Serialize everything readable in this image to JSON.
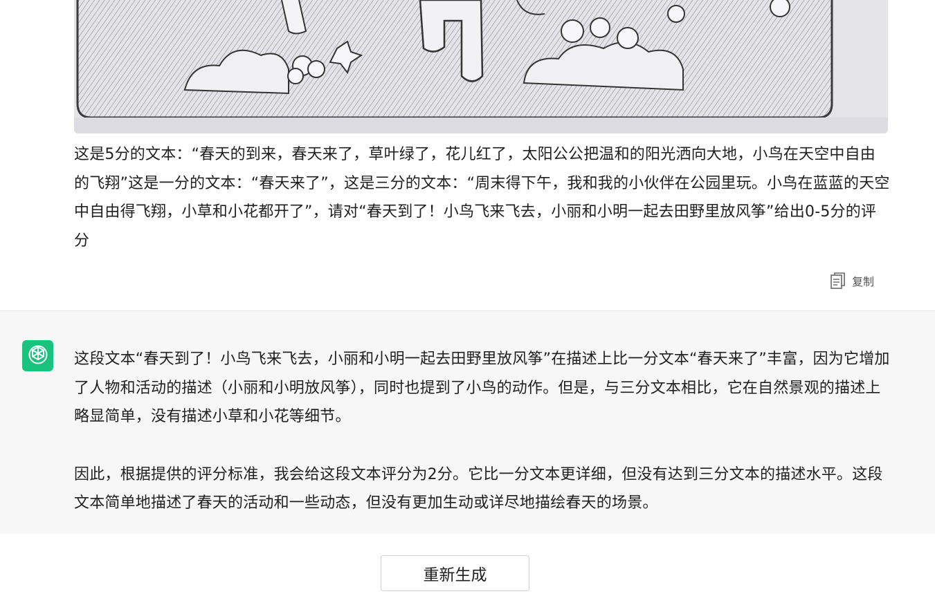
{
  "user_message": {
    "text": "这是5分的文本：“春天的到来，春天来了，草叶绿了，花儿红了，太阳公公把温和的阳光洒向大地，小鸟在天空中自由的飞翔”这是一分的文本：“春天来了”，这是三分的文本：“周末得下午，我和我的小伙伴在公园里玩。小鸟在蓝蓝的天空中自由得飞翔，小草和小花都开了”，请对“春天到了！小鸟飞来飞去，小丽和小明一起去田野里放风筝”给出0-5分的评分",
    "copy_label": "复制"
  },
  "assistant_message": {
    "paragraph1": "这段文本“春天到了！小鸟飞来飞去，小丽和小明一起去田野里放风筝”在描述上比一分文本“春天来了”丰富，因为它增加了人物和活动的描述（小丽和小明放风筝），同时也提到了小鸟的动作。但是，与三分文本相比，它在自然景观的描述上略显简单，没有描述小草和小花等细节。",
    "paragraph2": "因此，根据提供的评分标准，我会给这段文本评分为2分。它比一分文本更详细，但没有达到三分文本的描述水平。这段文本简单地描述了春天的活动和一些动态，但没有更加生动或详尽地描绘春天的场景。"
  },
  "regenerate_label": "重新生成",
  "colors": {
    "avatar_bg": "#19c37d",
    "assistant_bg": "#f7f7f7"
  },
  "icons": {
    "copy": "copy-icon",
    "avatar": "openai-logo-icon"
  }
}
